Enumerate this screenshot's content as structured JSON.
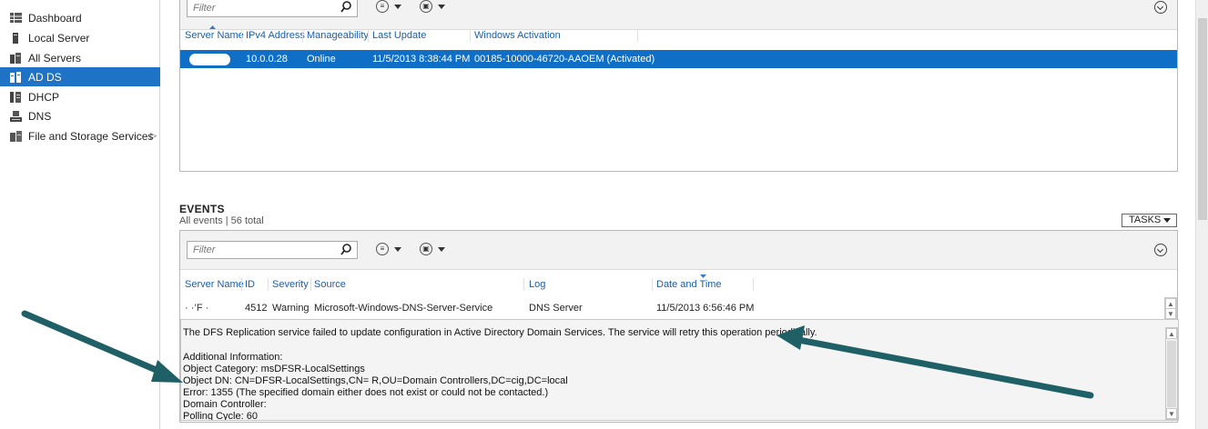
{
  "sidebar": {
    "items": [
      {
        "label": "Dashboard",
        "icon": "dashboard-icon",
        "selected": false
      },
      {
        "label": "Local Server",
        "icon": "server-icon",
        "selected": false
      },
      {
        "label": "All Servers",
        "icon": "servers-icon",
        "selected": false
      },
      {
        "label": "AD DS",
        "icon": "ad-ds-icon",
        "selected": true
      },
      {
        "label": "DHCP",
        "icon": "dhcp-icon",
        "selected": false
      },
      {
        "label": "DNS",
        "icon": "dns-icon",
        "selected": false
      },
      {
        "label": "File and Storage Services",
        "icon": "file-storage-icon",
        "selected": false
      }
    ],
    "expand_arrow": "▷"
  },
  "servers": {
    "filter_placeholder": "Filter",
    "columns": [
      "Server Name",
      "IPv4 Address",
      "Manageability",
      "Last Update",
      "Windows Activation"
    ],
    "rows": [
      {
        "server_name": "",
        "ipv4": "10.0.0.28",
        "manageability": "Online",
        "last_update": "11/5/2013 8:38:44 PM",
        "activation": "00185-10000-46720-AAOEM (Activated)"
      }
    ]
  },
  "events": {
    "title": "EVENTS",
    "subtitle": "All events | 56 total",
    "tasks_label": "TASKS",
    "filter_placeholder": "Filter",
    "columns": [
      "Server Name",
      "ID",
      "Severity",
      "Source",
      "Log",
      "Date and Time"
    ],
    "rows": [
      {
        "server_name": "·  ·’F  ·",
        "id": "4512",
        "severity": "Warning",
        "source": "Microsoft-Windows-DNS-Server-Service",
        "log": "DNS Server",
        "date_time": "11/5/2013 6:56:46 PM"
      }
    ],
    "detail_lines": [
      "The DFS Replication service failed to update configuration in Active Directory Domain Services. The service will retry this operation periodically.",
      "",
      "Additional Information:",
      "Object Category: msDFSR-LocalSettings",
      "Object DN: CN=DFSR-LocalSettings,CN=            R,OU=Domain Controllers,DC=cig,DC=local",
      "Error: 1355 (The specified domain either does not exist or could not be contacted.)",
      "Domain Controller:",
      "Polling Cycle: 60"
    ]
  },
  "colors": {
    "selection": "#1e73c7",
    "header_text": "#1a5fa8",
    "annotation_arrow": "#1f5f66"
  }
}
